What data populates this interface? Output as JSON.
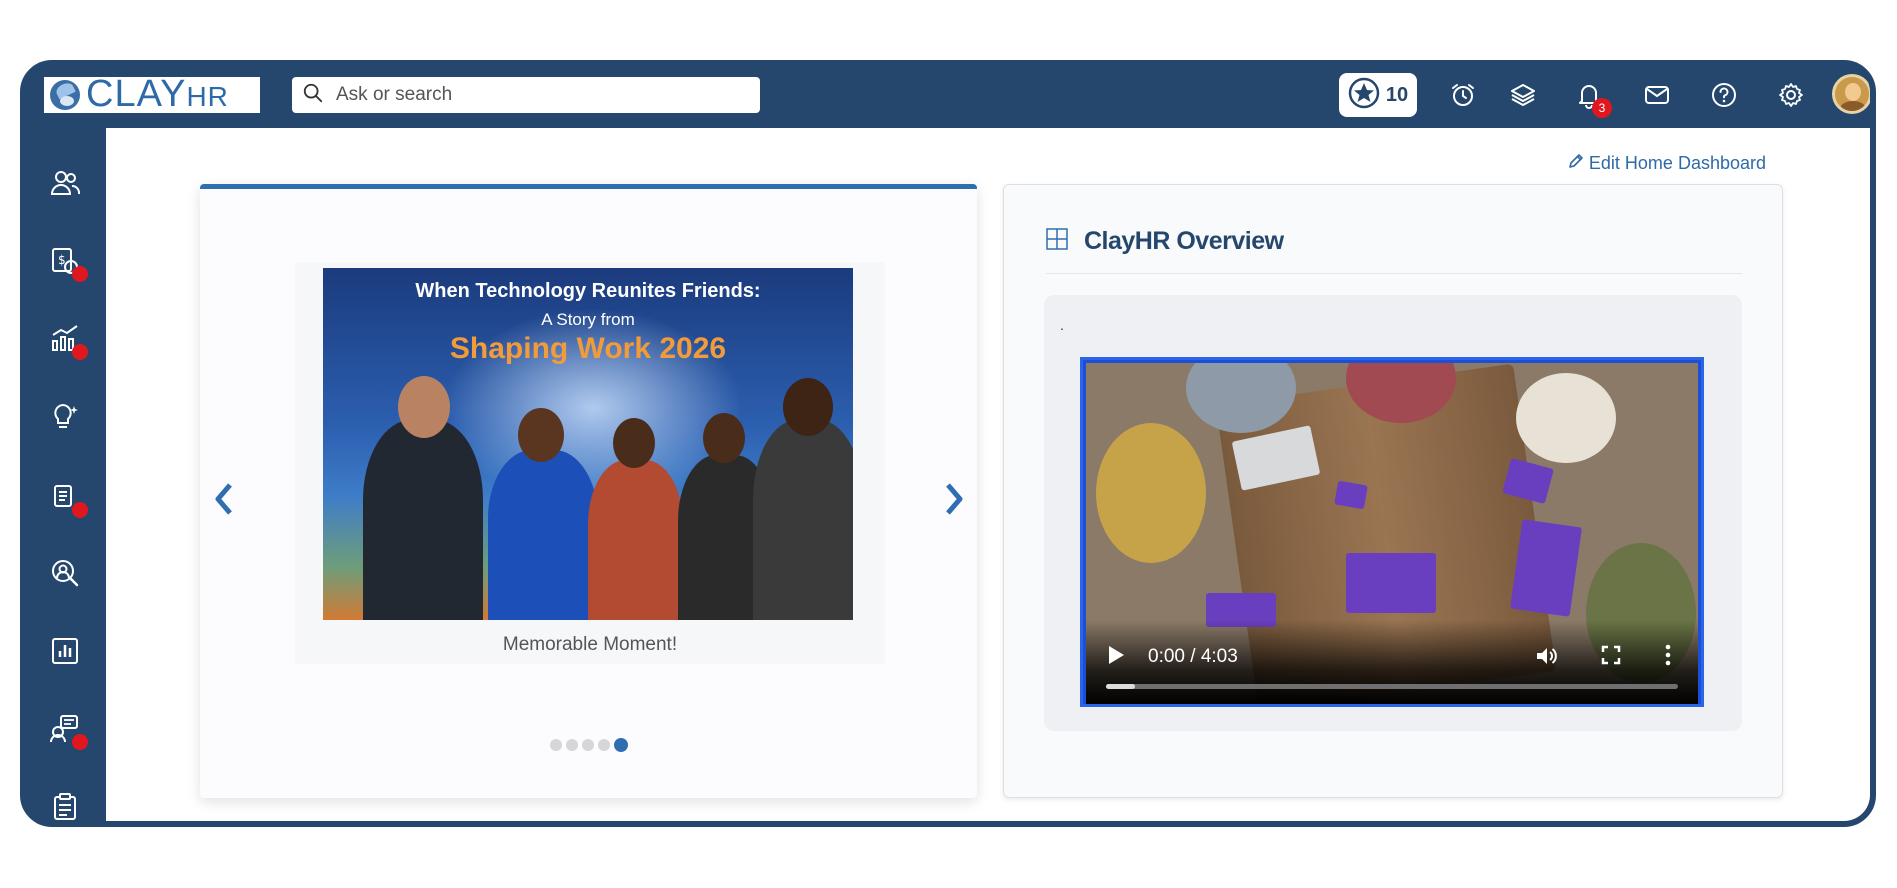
{
  "app": {
    "logo_main": "CLAY",
    "logo_sub": "HR"
  },
  "topbar": {
    "search_placeholder": "Ask or search",
    "points_count": "10",
    "notification_count": "3",
    "icons": [
      "star-icon",
      "alarm-clock-icon",
      "layers-icon",
      "bell-icon",
      "mail-icon",
      "help-icon",
      "gear-icon"
    ]
  },
  "sidebar": {
    "items": [
      {
        "icon": "people-icon",
        "has_alert": false
      },
      {
        "icon": "payroll-icon",
        "has_alert": true
      },
      {
        "icon": "growth-chart-icon",
        "has_alert": true
      },
      {
        "icon": "idea-bulb-icon",
        "has_alert": false
      },
      {
        "icon": "documents-icon",
        "has_alert": true
      },
      {
        "icon": "employee-search-icon",
        "has_alert": false
      },
      {
        "icon": "reports-icon",
        "has_alert": false
      },
      {
        "icon": "assistant-icon",
        "has_alert": true
      },
      {
        "icon": "clipboard-icon",
        "has_alert": false
      }
    ]
  },
  "dashboard": {
    "edit_link": "Edit Home Dashboard"
  },
  "carousel": {
    "image_title_line1": "When Technology Reunites Friends:",
    "image_title_line2": "A Story from",
    "image_title_line3": "Shaping Work 2026",
    "caption": "Memorable Moment!",
    "slide_count": 5,
    "active_slide": 5
  },
  "overview": {
    "title": "ClayHR Overview",
    "panel_text": ".",
    "video": {
      "time": "0:00 / 4:03",
      "progress_fraction": 0.05
    }
  },
  "colors": {
    "brand_navy": "#25476d",
    "accent_blue": "#2f6eb1",
    "alert_red": "#e0171f"
  }
}
